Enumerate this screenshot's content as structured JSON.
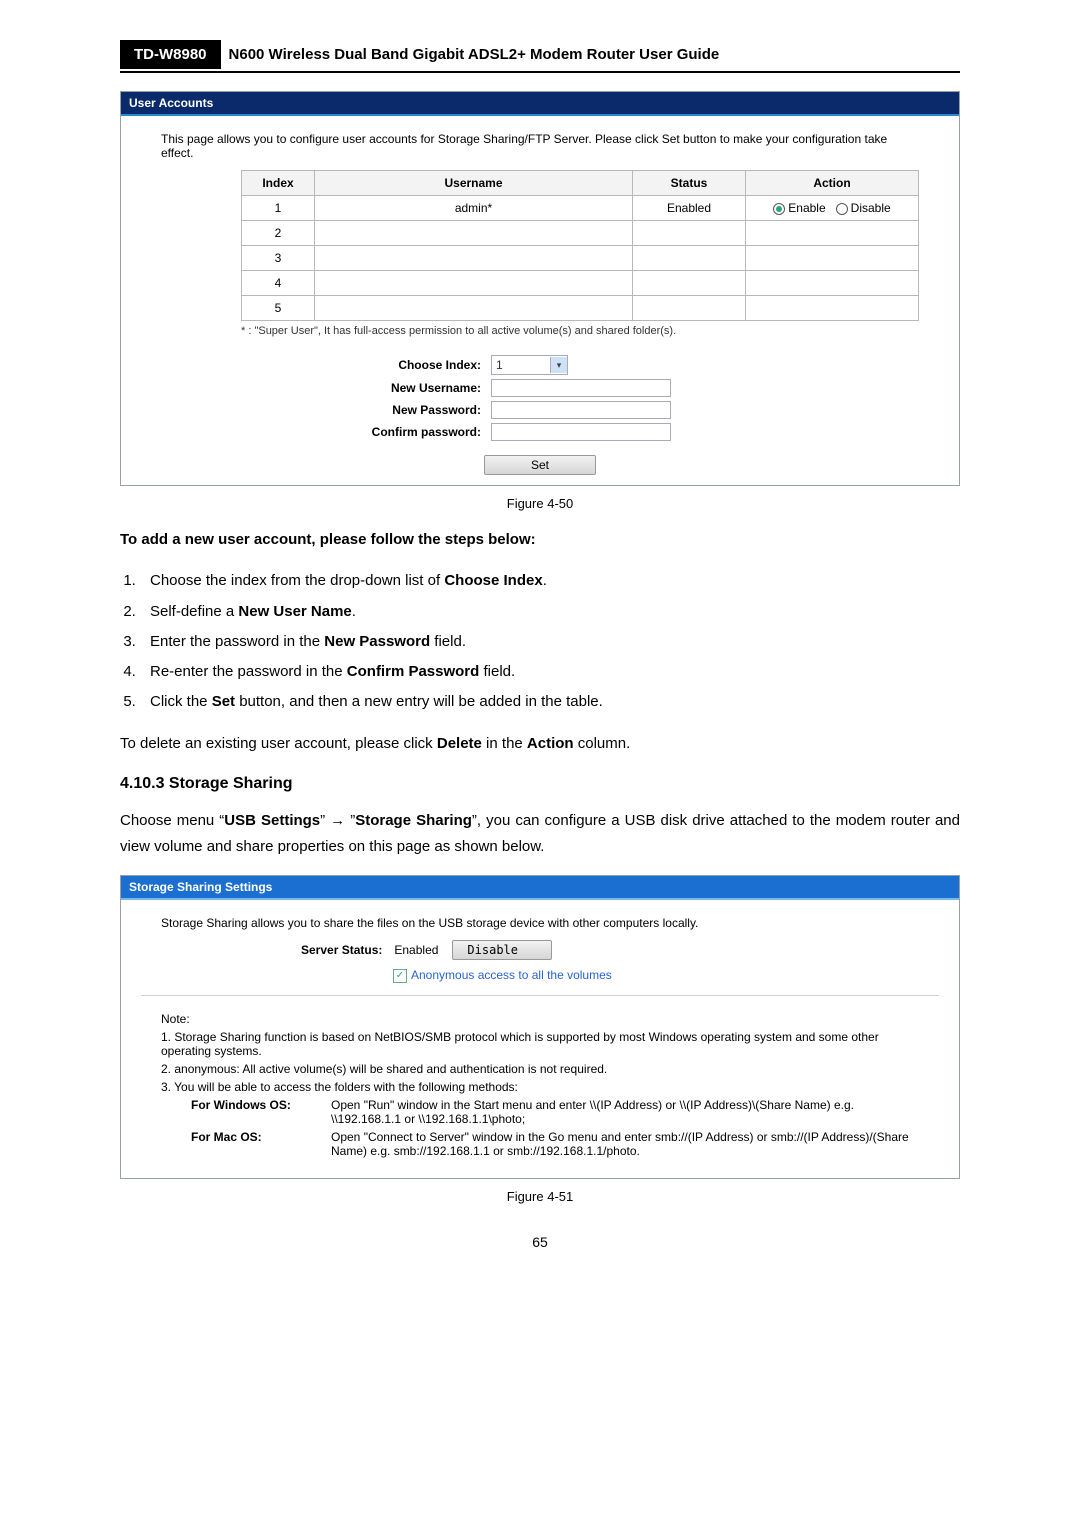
{
  "doc_header": {
    "model": "TD-W8980",
    "title": "N600 Wireless Dual Band Gigabit ADSL2+ Modem Router User Guide"
  },
  "panel1": {
    "title": "User Accounts",
    "desc": "This page allows you to configure user accounts for Storage Sharing/FTP Server. Please click Set button to make your configuration take effect.",
    "headers": {
      "index": "Index",
      "username": "Username",
      "status": "Status",
      "action": "Action"
    },
    "rows": [
      {
        "index": "1",
        "username": "admin*",
        "status": "Enabled",
        "enable": "Enable",
        "disable": "Disable"
      },
      {
        "index": "2",
        "username": "",
        "status": "",
        "enable": "",
        "disable": ""
      },
      {
        "index": "3",
        "username": "",
        "status": "",
        "enable": "",
        "disable": ""
      },
      {
        "index": "4",
        "username": "",
        "status": "",
        "enable": "",
        "disable": ""
      },
      {
        "index": "5",
        "username": "",
        "status": "",
        "enable": "",
        "disable": ""
      }
    ],
    "footnote": "* : \"Super User\", It has full-access permission to all active volume(s) and shared folder(s).",
    "form": {
      "choose_index_label": "Choose Index:",
      "choose_index_value": "1",
      "new_username_label": "New Username:",
      "new_password_label": "New Password:",
      "confirm_password_label": "Confirm password:"
    },
    "set_label": "Set"
  },
  "fig1": "Figure 4-50",
  "instructions": {
    "intro": "To add a new user account, please follow the steps below:",
    "steps": [
      {
        "pre": "Choose the index from the drop-down list of ",
        "bold": "Choose Index",
        "post": "."
      },
      {
        "pre": "Self-define a ",
        "bold": "New User Name",
        "post": "."
      },
      {
        "pre": "Enter the password in the ",
        "bold": "New Password",
        "post": " field."
      },
      {
        "pre": "Re-enter the password in the ",
        "bold": "Confirm Password",
        "post": " field."
      },
      {
        "pre": "Click the ",
        "bold": "Set",
        "post": " button, and then a new entry will be added in the table."
      }
    ],
    "delete_pre": "To delete an existing user account, please click ",
    "delete_bold1": "Delete",
    "delete_mid": " in the ",
    "delete_bold2": "Action",
    "delete_post": " column."
  },
  "section": {
    "heading": "4.10.3 Storage Sharing",
    "para_pre": "Choose menu “",
    "para_b1": "USB Settings",
    "para_mid": "” → ”",
    "para_b2": "Storage Sharing",
    "para_post": "”, you can configure a USB disk drive attached to the modem router and view volume and share properties on this page as shown below."
  },
  "panel2": {
    "title": "Storage Sharing Settings",
    "desc": "Storage Sharing allows you to share the files on the USB storage device with other computers locally.",
    "server_status_label": "Server Status:",
    "server_status_value": "Enabled",
    "disable_btn": "Disable",
    "anon_label": "Anonymous access to all the volumes",
    "note_label": "Note:",
    "note1": "1. Storage Sharing function is based on NetBIOS/SMB protocol which is supported by most Windows operating system and some other operating systems.",
    "note2": "2. anonymous: All active volume(s) will be shared and authentication is not required.",
    "note3": "3. You will be able to access the folders with the following methods:",
    "win_label": "For Windows OS:",
    "win_text": "Open \"Run\" window in the Start menu and enter \\\\(IP Address) or \\\\(IP Address)\\(Share Name) e.g. \\\\192.168.1.1 or \\\\192.168.1.1\\photo;",
    "mac_label": "For Mac OS:",
    "mac_text": "Open \"Connect to Server\" window in the Go menu and enter smb://(IP Address) or smb://(IP Address)/(Share Name) e.g. smb://192.168.1.1 or smb://192.168.1.1/photo."
  },
  "fig2": "Figure 4-51",
  "page_num": "65"
}
